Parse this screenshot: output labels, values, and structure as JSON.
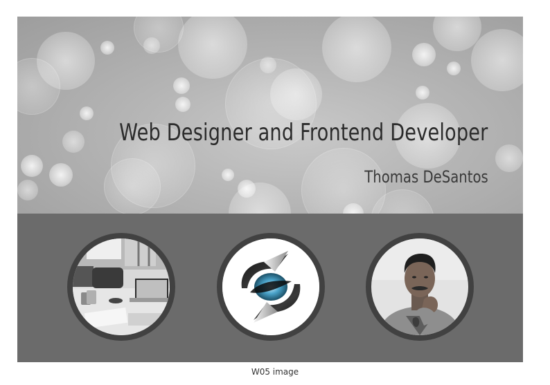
{
  "banner": {
    "title": "Web Designer and Frontend Developer",
    "subtitle": "Thomas DeSantos"
  },
  "thumbnails": [
    {
      "name": "office-desk-photo"
    },
    {
      "name": "s-logo"
    },
    {
      "name": "person-portrait-photo"
    }
  ],
  "caption": "W05 image",
  "colors": {
    "strip_background": "#6b6b6b",
    "circle_border": "#414141",
    "title_text": "#2b2b2b"
  }
}
